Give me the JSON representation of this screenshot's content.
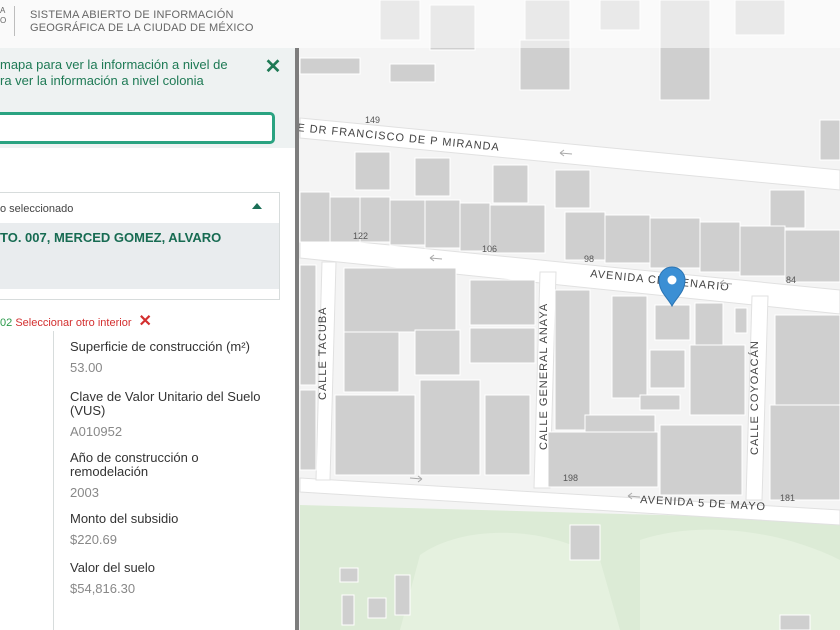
{
  "header": {
    "title_line1": "SISTEMA ABIERTO DE INFORMACIÓN",
    "title_line2": "GEOGRÁFICA DE LA CIUDAD DE MÉXICO",
    "logo_line1": "A",
    "logo_line2": "O"
  },
  "panel": {
    "instruction_line1": "mapa para ver la información a nivel de",
    "instruction_line2": "ra ver la información a nivel colonia",
    "search_value": "",
    "selected_label": "o seleccionado",
    "selected_value": "TO. 007, MERCED GOMEZ, ALVARO",
    "interior_code": "02",
    "interior_link": "Seleccionar otro interior",
    "details": [
      {
        "label": "Superficie de construcción (m²)",
        "value": "53.00"
      },
      {
        "label": "Clave de Valor Unitario del Suelo (VUS)",
        "value": "A010952"
      },
      {
        "label": "Año de construcción o remodelación",
        "value": "2003"
      },
      {
        "label": "Monto del subsidio",
        "value": "$220.69"
      },
      {
        "label": "Valor del suelo",
        "value": "$54,816.30"
      }
    ]
  },
  "map": {
    "streets": {
      "top": "E DR FRANCISCO DE P MIRANDA",
      "centenario": "AVENIDA CENTENARIO",
      "cinco_mayo": "AVENIDA 5 DE MAYO",
      "tacuba": "CALLE TACUBA",
      "anaya": "CALLE GENERAL ANAYA",
      "coyoacan": "CALLE COYOACÁN"
    },
    "numbers": [
      "149",
      "122",
      "106",
      "98",
      "84",
      "198",
      "181"
    ],
    "marker_color": "#3b8fd4",
    "building_color": "#cfcfcf",
    "park_color": "#dcebd6"
  }
}
